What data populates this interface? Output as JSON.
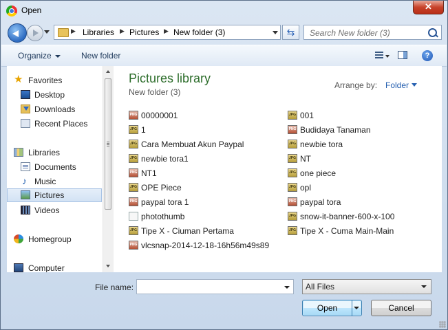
{
  "window": {
    "title": "Open",
    "close_label": "✕"
  },
  "address": {
    "crumbs": [
      "Libraries",
      "Pictures",
      "New folder (3)"
    ],
    "search_placeholder": "Search New folder (3)"
  },
  "toolbar": {
    "organize_label": "Organize",
    "new_folder_label": "New folder"
  },
  "nav": {
    "favorites": "Favorites",
    "desktop": "Desktop",
    "downloads": "Downloads",
    "recent_places": "Recent Places",
    "libraries": "Libraries",
    "documents": "Documents",
    "music": "Music",
    "pictures": "Pictures",
    "videos": "Videos",
    "homegroup": "Homegroup",
    "computer": "Computer"
  },
  "content": {
    "library_title": "Pictures library",
    "library_subtitle": "New folder (3)",
    "arrange_label": "Arrange by:",
    "arrange_value": "Folder",
    "files": [
      {
        "name": "00000001",
        "type": "png"
      },
      {
        "name": "001",
        "type": "jpg"
      },
      {
        "name": "1",
        "type": "jpg"
      },
      {
        "name": "Budidaya Tanaman",
        "type": "png"
      },
      {
        "name": "Cara Membuat Akun Paypal",
        "type": "jpg"
      },
      {
        "name": "newbie tora",
        "type": "jpg"
      },
      {
        "name": "newbie tora1",
        "type": "jpg"
      },
      {
        "name": "NT",
        "type": "jpg"
      },
      {
        "name": "NT1",
        "type": "png"
      },
      {
        "name": "one piece",
        "type": "jpg"
      },
      {
        "name": "OPE Piece",
        "type": "jpg"
      },
      {
        "name": "opl",
        "type": "jpg"
      },
      {
        "name": "paypal tora 1",
        "type": "png"
      },
      {
        "name": "paypal tora",
        "type": "png"
      },
      {
        "name": "photothumb",
        "type": "gen"
      },
      {
        "name": "snow-it-banner-600-x-100",
        "type": "jpg"
      },
      {
        "name": "Tipe X - Ciuman Pertama",
        "type": "jpg"
      },
      {
        "name": "Tipe X - Cuma Main-Main",
        "type": "jpg"
      },
      {
        "name": "vlcsnap-2014-12-18-16h56m49s89",
        "type": "png"
      }
    ]
  },
  "footer": {
    "filename_label": "File name:",
    "filename_value": "",
    "filetype_value": "All Files",
    "open_label": "Open",
    "cancel_label": "Cancel"
  },
  "colors": {
    "title_green": "#2e6e2c",
    "link_blue": "#2660b0",
    "close_red": "#c7432b"
  }
}
